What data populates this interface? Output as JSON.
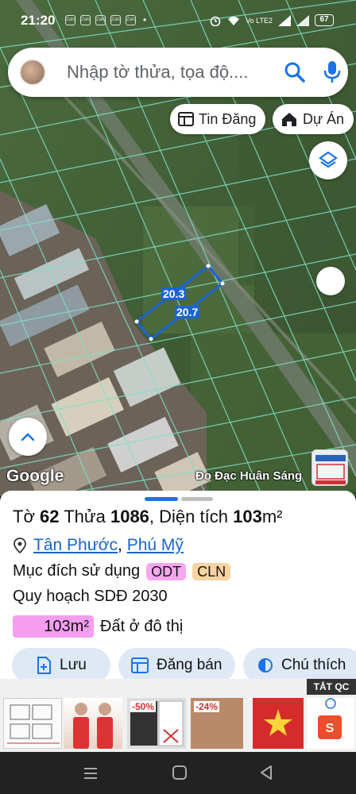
{
  "status_bar": {
    "time": "21:20",
    "notif_icon_text": "Zalo",
    "network": "Vo LTE2",
    "battery": "67"
  },
  "search": {
    "placeholder": "Nhập tờ thửa, tọa độ...."
  },
  "chips": {
    "tin_dang": "Tin Đăng",
    "du_an": "Dự Án"
  },
  "map": {
    "dim_top": "20.3",
    "dim_bottom": "20.7",
    "google_label": "Google",
    "brand_label": "Đo Đạc Huân Sáng"
  },
  "parcel": {
    "sheet_label": "Tờ",
    "sheet_no": "62",
    "plot_label": "Thửa",
    "plot_no": "1086",
    "area_label": ", Diện tích",
    "area_value": "103",
    "area_unit": "m²",
    "ward": "Tân Phước",
    "separator": ",",
    "district": "Phú Mỹ",
    "usage_label": "Mục đích sử dụng",
    "usage_tags": [
      "ODT",
      "CLN"
    ],
    "planning_label": "Quy hoạch SDĐ 2030",
    "planning_area": "103m²",
    "planning_type": "Đất ở đô thị"
  },
  "actions": {
    "save": "Lưu",
    "post": "Đăng bán",
    "note": "Chú thích"
  },
  "ads": {
    "close_label": "TẮT QC",
    "discount_1": "-50%",
    "discount_2": "-24%"
  },
  "colors": {
    "accent": "#1a73e8",
    "odt_tag": "#f7a7f0",
    "cln_tag": "#f9d3a0",
    "action_bg": "#dfe9f6"
  }
}
